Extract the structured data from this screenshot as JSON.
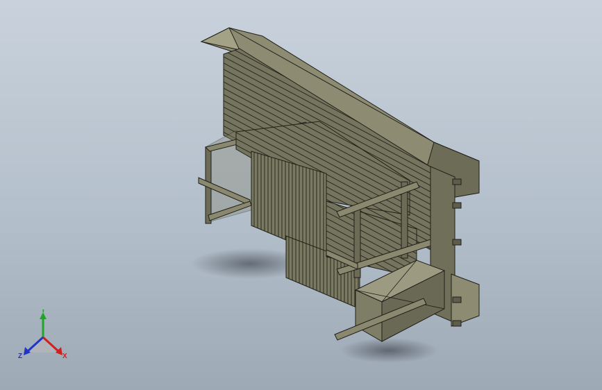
{
  "viewport": {
    "background_top": "#c9d2dc",
    "background_bottom": "#9ea9b6"
  },
  "model": {
    "body_color": "#7c7b64",
    "body_dark": "#4f4f3f",
    "body_light": "#9a9a80",
    "edge_color": "#1f1f18"
  },
  "triad": {
    "x_label": "X",
    "y_label": "Y",
    "z_label": "Z",
    "x_color": "#d11f1f",
    "y_color": "#1fa52a",
    "z_color": "#2233c8"
  }
}
